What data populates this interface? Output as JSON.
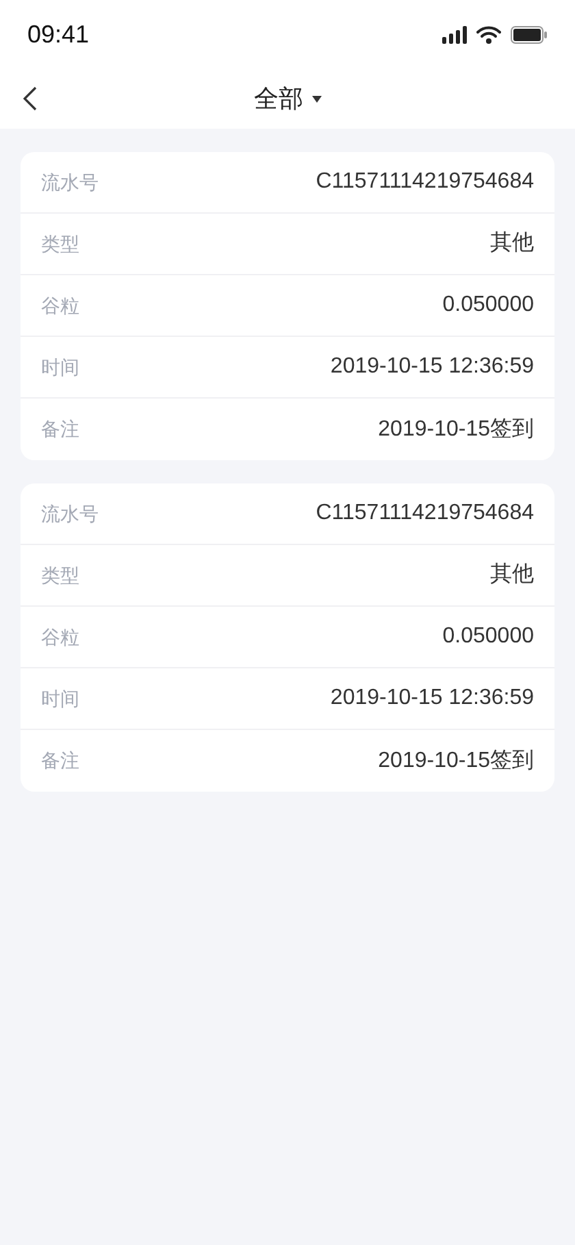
{
  "status_bar": {
    "time": "09:41"
  },
  "header": {
    "title": "全部"
  },
  "records": [
    {
      "fields": [
        {
          "label": "流水号",
          "value": "C11571114219754684"
        },
        {
          "label": "类型",
          "value": "其他"
        },
        {
          "label": "谷粒",
          "value": "0.050000"
        },
        {
          "label": "时间",
          "value": "2019-10-15 12:36:59"
        },
        {
          "label": "备注",
          "value": "2019-10-15签到"
        }
      ]
    },
    {
      "fields": [
        {
          "label": "流水号",
          "value": "C11571114219754684"
        },
        {
          "label": "类型",
          "value": "其他"
        },
        {
          "label": "谷粒",
          "value": "0.050000"
        },
        {
          "label": "时间",
          "value": "2019-10-15 12:36:59"
        },
        {
          "label": "备注",
          "value": "2019-10-15签到"
        }
      ]
    }
  ]
}
